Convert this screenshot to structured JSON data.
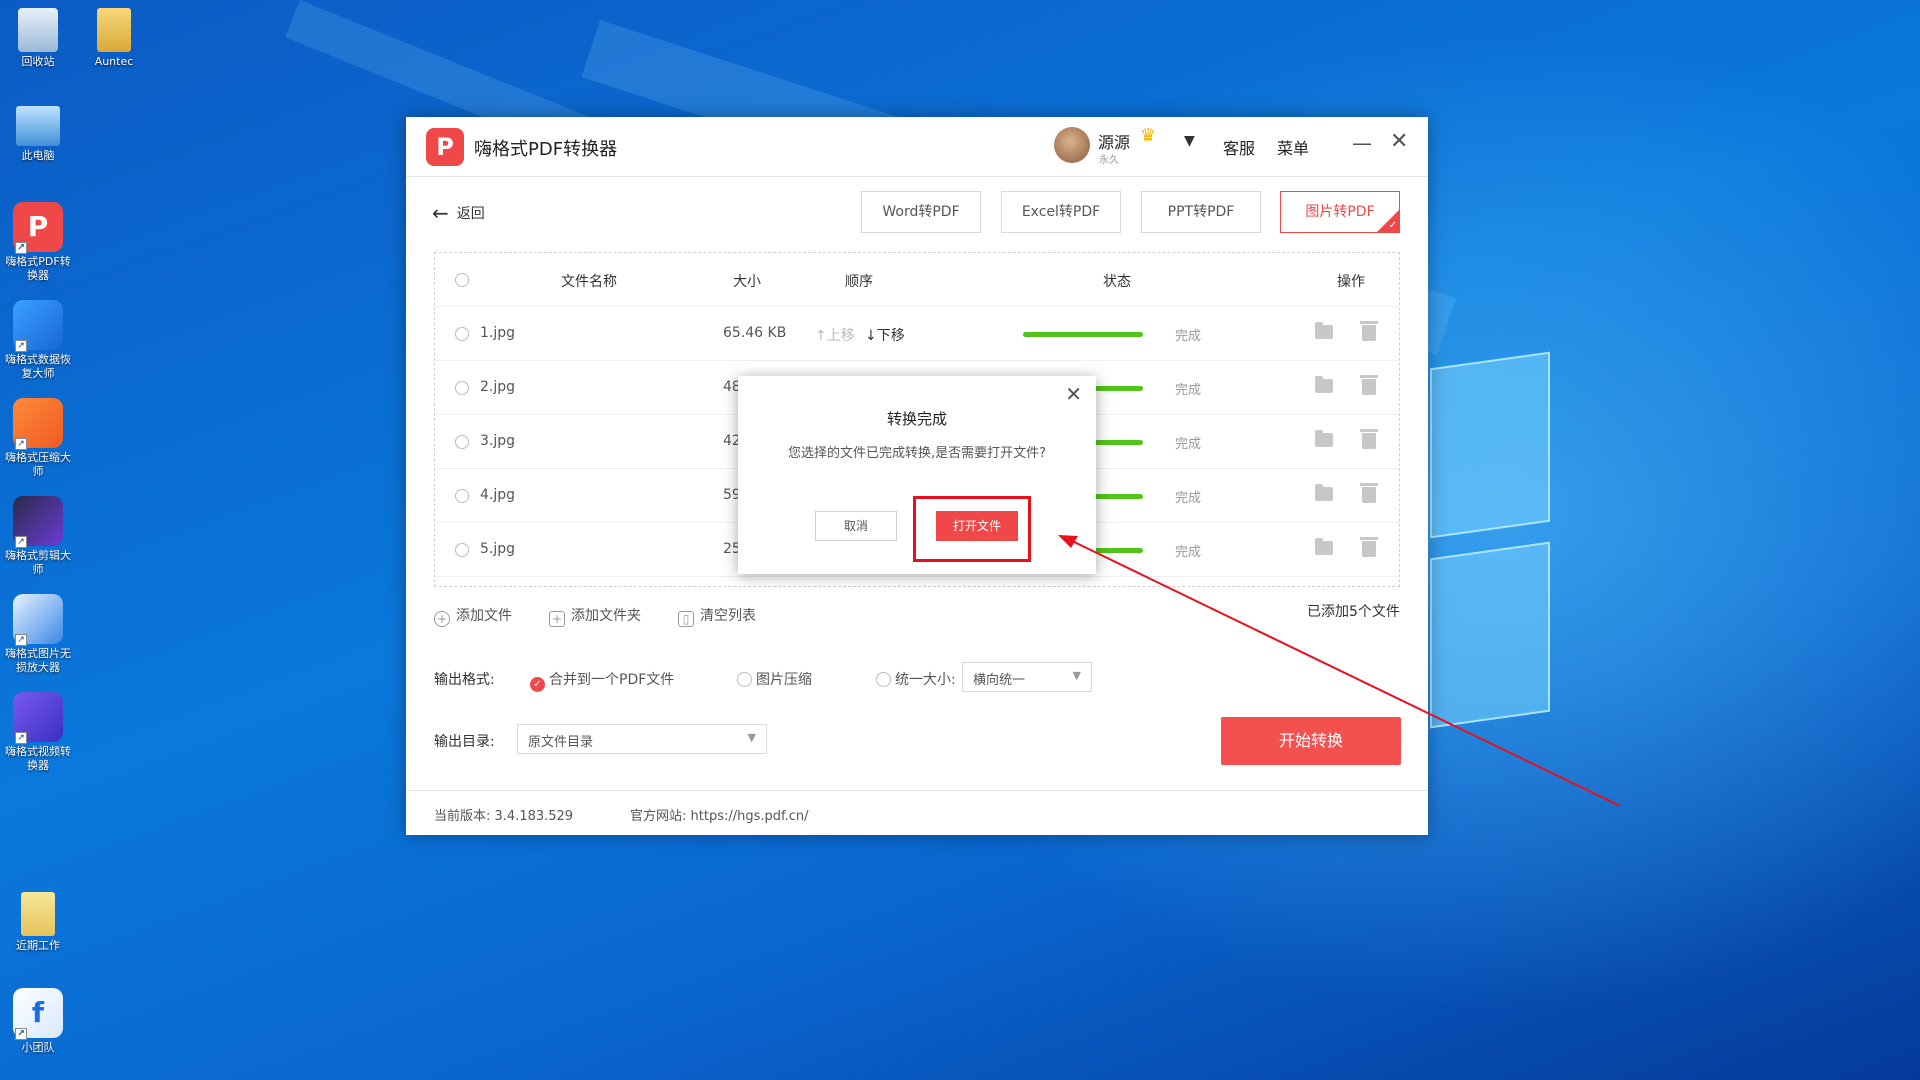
{
  "desktop": {
    "icons": [
      {
        "label": "回收站",
        "icon": "recycle-bin-icon"
      },
      {
        "label": "Auntec",
        "icon": "folder-icon"
      },
      {
        "label": "此电脑",
        "icon": "computer-icon"
      },
      {
        "label": "嗨格式PDF转换器",
        "icon": "pdf-converter-icon"
      },
      {
        "label": "嗨格式数据恢复大师",
        "icon": "data-recovery-icon"
      },
      {
        "label": "嗨格式压缩大师",
        "icon": "compress-icon"
      },
      {
        "label": "嗨格式剪辑大师",
        "icon": "video-edit-icon"
      },
      {
        "label": "嗨格式图片无损放大器",
        "icon": "image-enlarge-icon"
      },
      {
        "label": "嗨格式视频转换器",
        "icon": "video-convert-icon"
      },
      {
        "label": "近期工作",
        "icon": "folder-icon"
      },
      {
        "label": "小团队",
        "icon": "team-app-icon"
      }
    ]
  },
  "app": {
    "title": "嗨格式PDF转换器",
    "logo_glyph": "P",
    "user": {
      "name": "源源",
      "sub": "永久"
    },
    "links": {
      "service": "客服",
      "menu": "菜单"
    },
    "back_label": "返回",
    "tabs": [
      {
        "label": "Word转PDF",
        "active": false
      },
      {
        "label": "Excel转PDF",
        "active": false
      },
      {
        "label": "PPT转PDF",
        "active": false
      },
      {
        "label": "图片转PDF",
        "active": true
      }
    ],
    "table": {
      "headers": {
        "name": "文件名称",
        "size": "大小",
        "order": "顺序",
        "status": "状态",
        "action": "操作"
      },
      "rows": [
        {
          "name": "1.jpg",
          "size": "65.46 KB",
          "up": "上移",
          "down": "下移",
          "progress": 1.0,
          "status": "完成"
        },
        {
          "name": "2.jpg",
          "size": "48",
          "progress": 1.0,
          "status": "完成"
        },
        {
          "name": "3.jpg",
          "size": "42",
          "progress": 1.0,
          "status": "完成"
        },
        {
          "name": "4.jpg",
          "size": "59",
          "progress": 1.0,
          "status": "完成"
        },
        {
          "name": "5.jpg",
          "size": "25",
          "progress": 1.0,
          "status": "完成"
        }
      ]
    },
    "actions": {
      "add_file": "添加文件",
      "add_folder": "添加文件夹",
      "clear_list": "清空列表",
      "count": "已添加5个文件"
    },
    "output": {
      "format_label": "输出格式:",
      "opt_merge": "合并到一个PDF文件",
      "opt_compress": "图片压缩",
      "opt_unify": "统一大小:",
      "unify_select": "横向统一",
      "dir_label": "输出目录:",
      "dir_select": "原文件目录"
    },
    "start_button": "开始转换",
    "footer": {
      "version": "当前版本: 3.4.183.529",
      "website": "官方网站: https://hgs.pdf.cn/"
    }
  },
  "dialog": {
    "title": "转换完成",
    "message": "您选择的文件已完成转换,是否需要打开文件?",
    "cancel": "取消",
    "open": "打开文件"
  },
  "colors": {
    "accent": "#f04848",
    "progress": "#52c41a",
    "highlight": "#e8101a"
  }
}
